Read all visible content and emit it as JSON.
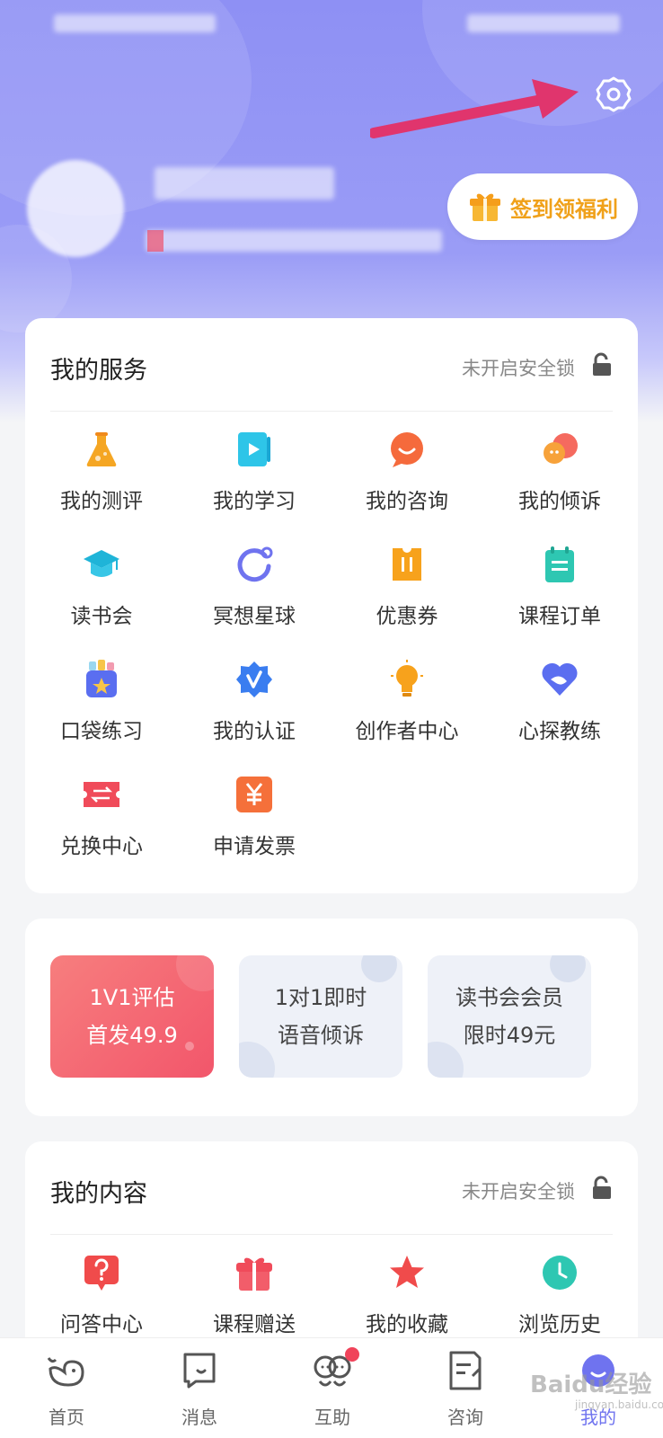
{
  "header": {
    "checkin_label": "签到领福利",
    "settings_icon": "gear-icon",
    "annotation_arrow_color": "#e0356d"
  },
  "services": {
    "title": "我的服务",
    "lock_text": "未开启安全锁",
    "items": [
      {
        "label": "我的测评",
        "icon": "flask-icon"
      },
      {
        "label": "我的学习",
        "icon": "video-play-icon"
      },
      {
        "label": "我的咨询",
        "icon": "chat-smile-icon"
      },
      {
        "label": "我的倾诉",
        "icon": "double-bubble-icon"
      },
      {
        "label": "读书会",
        "icon": "graduation-cap-icon"
      },
      {
        "label": "冥想星球",
        "icon": "orbit-ring-icon"
      },
      {
        "label": "优惠券",
        "icon": "coupon-icon"
      },
      {
        "label": "课程订单",
        "icon": "clipboard-icon"
      },
      {
        "label": "口袋练习",
        "icon": "pocket-star-icon"
      },
      {
        "label": "我的认证",
        "icon": "verified-badge-icon"
      },
      {
        "label": "创作者中心",
        "icon": "lightbulb-icon"
      },
      {
        "label": "心探教练",
        "icon": "heart-whale-icon"
      },
      {
        "label": "兑换中心",
        "icon": "exchange-ticket-icon"
      },
      {
        "label": "申请发票",
        "icon": "yuan-invoice-icon"
      }
    ]
  },
  "promos": [
    {
      "line1": "1V1评估",
      "line2": "首发49.9"
    },
    {
      "line1": "1对1即时",
      "line2": "语音倾诉"
    },
    {
      "line1": "读书会会员",
      "line2": "限时49元"
    }
  ],
  "content": {
    "title": "我的内容",
    "lock_text": "未开启安全锁",
    "items": [
      {
        "label": "问答中心",
        "icon": "question-icon"
      },
      {
        "label": "课程赠送",
        "icon": "gift-icon"
      },
      {
        "label": "我的收藏",
        "icon": "star-icon"
      },
      {
        "label": "浏览历史",
        "icon": "clock-icon"
      }
    ]
  },
  "tabbar": [
    {
      "label": "首页",
      "icon": "whale-icon"
    },
    {
      "label": "消息",
      "icon": "message-icon"
    },
    {
      "label": "互助",
      "icon": "mutual-help-icon"
    },
    {
      "label": "咨询",
      "icon": "consult-icon"
    },
    {
      "label": "我的",
      "icon": "profile-smile-icon"
    }
  ],
  "watermark": {
    "text": "Baidu经验",
    "sub": "jingyan.baidu.com"
  },
  "colors": {
    "accent": "#6f73ef",
    "checkin": "#f0a11a",
    "promo_hot": "#f56a72"
  }
}
